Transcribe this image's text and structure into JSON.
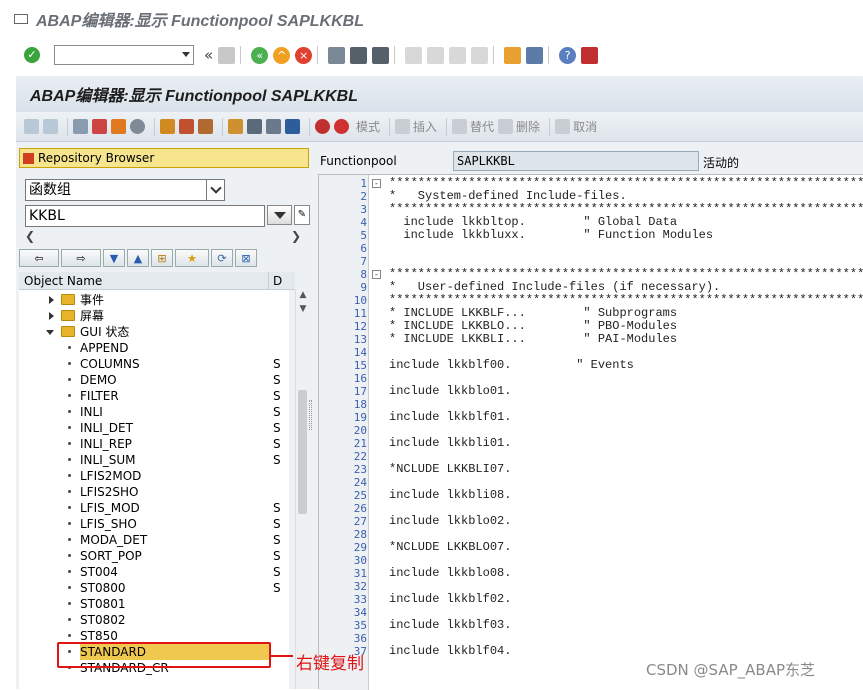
{
  "window": {
    "title": "ABAP编辑器:显示 Functionpool SAPLKKBL"
  },
  "header": {
    "title": "ABAP编辑器:显示 Functionpool SAPLKKBL"
  },
  "toolbar": {
    "command_value": "",
    "back_symbol": "«"
  },
  "appbar": {
    "pattern": "模式",
    "insert": "插入",
    "replace": "替代",
    "delete": "删除",
    "cancel": "取消"
  },
  "left": {
    "repo_label": "Repository Browser",
    "object_type": "函数组",
    "object_name": "KKBL",
    "col_object": "Object Name",
    "col_d": "D",
    "tree": [
      {
        "name": "事件",
        "kind": "folder",
        "expander": "right",
        "desc": ""
      },
      {
        "name": "屏幕",
        "kind": "folder",
        "expander": "right",
        "desc": ""
      },
      {
        "name": "GUI 状态",
        "kind": "folder",
        "expander": "down",
        "desc": ""
      },
      {
        "name": "APPEND",
        "kind": "leaf",
        "desc": ""
      },
      {
        "name": "COLUMNS",
        "kind": "leaf",
        "desc": "S"
      },
      {
        "name": "DEMO",
        "kind": "leaf",
        "desc": "S"
      },
      {
        "name": "FILTER",
        "kind": "leaf",
        "desc": "S"
      },
      {
        "name": "INLI",
        "kind": "leaf",
        "desc": "S"
      },
      {
        "name": "INLI_DET",
        "kind": "leaf",
        "desc": "S"
      },
      {
        "name": "INLI_REP",
        "kind": "leaf",
        "desc": "S"
      },
      {
        "name": "INLI_SUM",
        "kind": "leaf",
        "desc": "S"
      },
      {
        "name": "LFIS2MOD",
        "kind": "leaf",
        "desc": ""
      },
      {
        "name": "LFIS2SHO",
        "kind": "leaf",
        "desc": ""
      },
      {
        "name": "LFIS_MOD",
        "kind": "leaf",
        "desc": "S"
      },
      {
        "name": "LFIS_SHO",
        "kind": "leaf",
        "desc": "S"
      },
      {
        "name": "MODA_DET",
        "kind": "leaf",
        "desc": "S"
      },
      {
        "name": "SORT_POP",
        "kind": "leaf",
        "desc": "S"
      },
      {
        "name": "ST004",
        "kind": "leaf",
        "desc": "S"
      },
      {
        "name": "ST0800",
        "kind": "leaf",
        "desc": "S"
      },
      {
        "name": "ST0801",
        "kind": "leaf",
        "desc": ""
      },
      {
        "name": "ST0802",
        "kind": "leaf",
        "desc": ""
      },
      {
        "name": "ST850",
        "kind": "leaf",
        "desc": ""
      },
      {
        "name": "STANDARD",
        "kind": "leaf",
        "desc": "",
        "selected": true
      },
      {
        "name": "STANDARD_CR",
        "kind": "leaf",
        "desc": ""
      }
    ]
  },
  "right": {
    "label": "Functionpool",
    "value": "SAPLKKBL",
    "status": "活动的"
  },
  "editor": {
    "lines": [
      "*******************************************************************",
      "*   System-defined Include-files.                                 *",
      "*******************************************************************",
      "  include lkkbltop.        \" Global Data",
      "  include lkkbluxx.        \" Function Modules",
      "",
      "",
      "*******************************************************************",
      "*   User-defined Include-files (if necessary).                    *",
      "*******************************************************************",
      "* INCLUDE LKKBLF...        \" Subprograms",
      "* INCLUDE LKKBLO...        \" PBO-Modules",
      "* INCLUDE LKKBLI...        \" PAI-Modules",
      "",
      "include lkkblf00.         \" Events",
      "",
      "include lkkblo01.",
      "",
      "include lkkblf01.",
      "",
      "include lkkbli01.",
      "",
      "*NCLUDE LKKBLI07.",
      "",
      "include lkkbli08.",
      "",
      "include lkkblo02.",
      "",
      "*NCLUDE LKKBLO07.",
      "",
      "include lkkblo08.",
      "",
      "include lkkblf02.",
      "",
      "include lkkblf03.",
      "",
      "include lkkblf04."
    ],
    "fold_lines": [
      1,
      8
    ]
  },
  "annotation": {
    "note": "右键复制",
    "watermark": "CSDN @SAP_ABAP东芝"
  },
  "colors": {
    "accent_red": "#e01414",
    "repo_yellow": "#f6e58d",
    "selection_yellow": "#f0c850"
  }
}
